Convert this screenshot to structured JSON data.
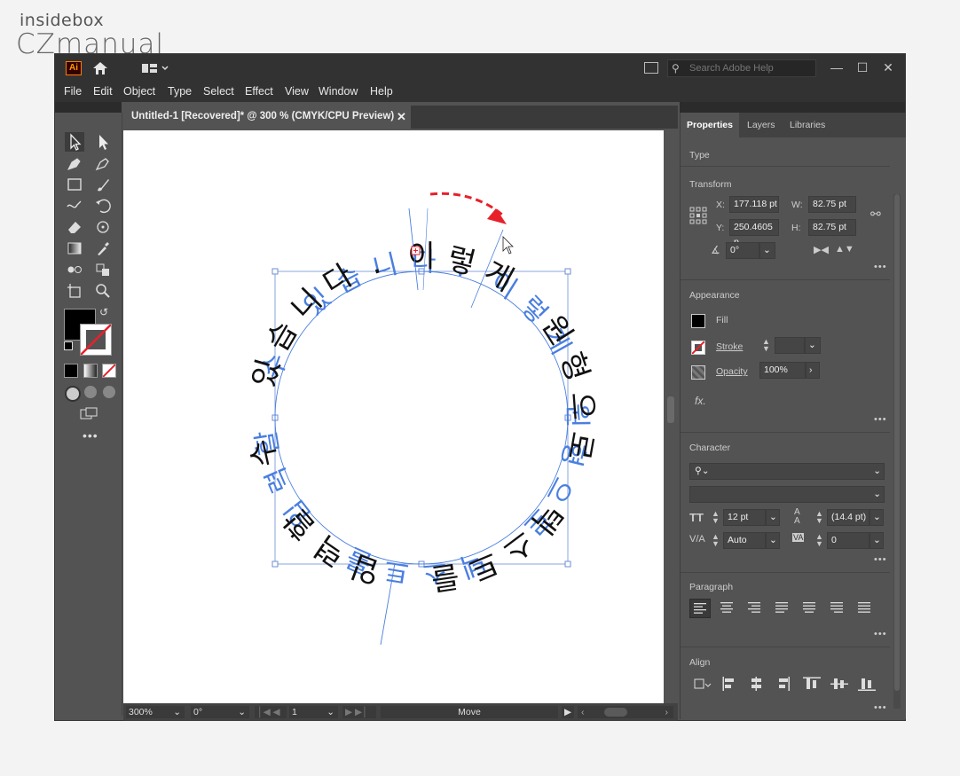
{
  "watermark": {
    "line1": "insidebox",
    "line2": "CZmanual"
  },
  "app": {
    "logo": "Ai",
    "search_placeholder": "Search Adobe Help",
    "window_controls": [
      "—",
      "☐",
      "✕"
    ]
  },
  "menu": [
    "File",
    "Edit",
    "Object",
    "Type",
    "Select",
    "Effect",
    "View",
    "Window",
    "Help"
  ],
  "document": {
    "tab_title": "Untitled-1 [Recovered]* @ 300 % (CMYK/CPU Preview)",
    "close": "✕"
  },
  "artwork": {
    "circle_text": [
      "이",
      "렇",
      "게",
      " ",
      "원",
      "형",
      "으",
      "로",
      " ",
      "텍",
      "스",
      "트",
      "를",
      " ",
      "입",
      "력",
      "할",
      " ",
      "수",
      " ",
      "있",
      "습",
      "니",
      "다",
      "."
    ],
    "accent_color": "#e8202a",
    "selection_color": "#4a7fe0"
  },
  "status": {
    "zoom": "300%",
    "rotation": "0°",
    "artboard": "1",
    "tool": "Move"
  },
  "properties": {
    "tabs": [
      "Properties",
      "Layers",
      "Libraries"
    ],
    "type_label": "Type",
    "transform": {
      "title": "Transform",
      "x_label": "X:",
      "x": "177.118 pt",
      "y_label": "Y:",
      "y": "250.4605 p",
      "w_label": "W:",
      "w": "82.75 pt",
      "h_label": "H:",
      "h": "82.75 pt",
      "angle": "0°"
    },
    "appearance": {
      "title": "Appearance",
      "fill": "Fill",
      "stroke": "Stroke",
      "opacity_label": "Opacity",
      "opacity": "100%",
      "fx": "fx."
    },
    "character": {
      "title": "Character",
      "font_search": "",
      "font_style": "",
      "size": "12 pt",
      "leading": "(14.4 pt)",
      "kerning": "Auto",
      "tracking": "0"
    },
    "paragraph": {
      "title": "Paragraph"
    },
    "align": {
      "title": "Align"
    }
  }
}
